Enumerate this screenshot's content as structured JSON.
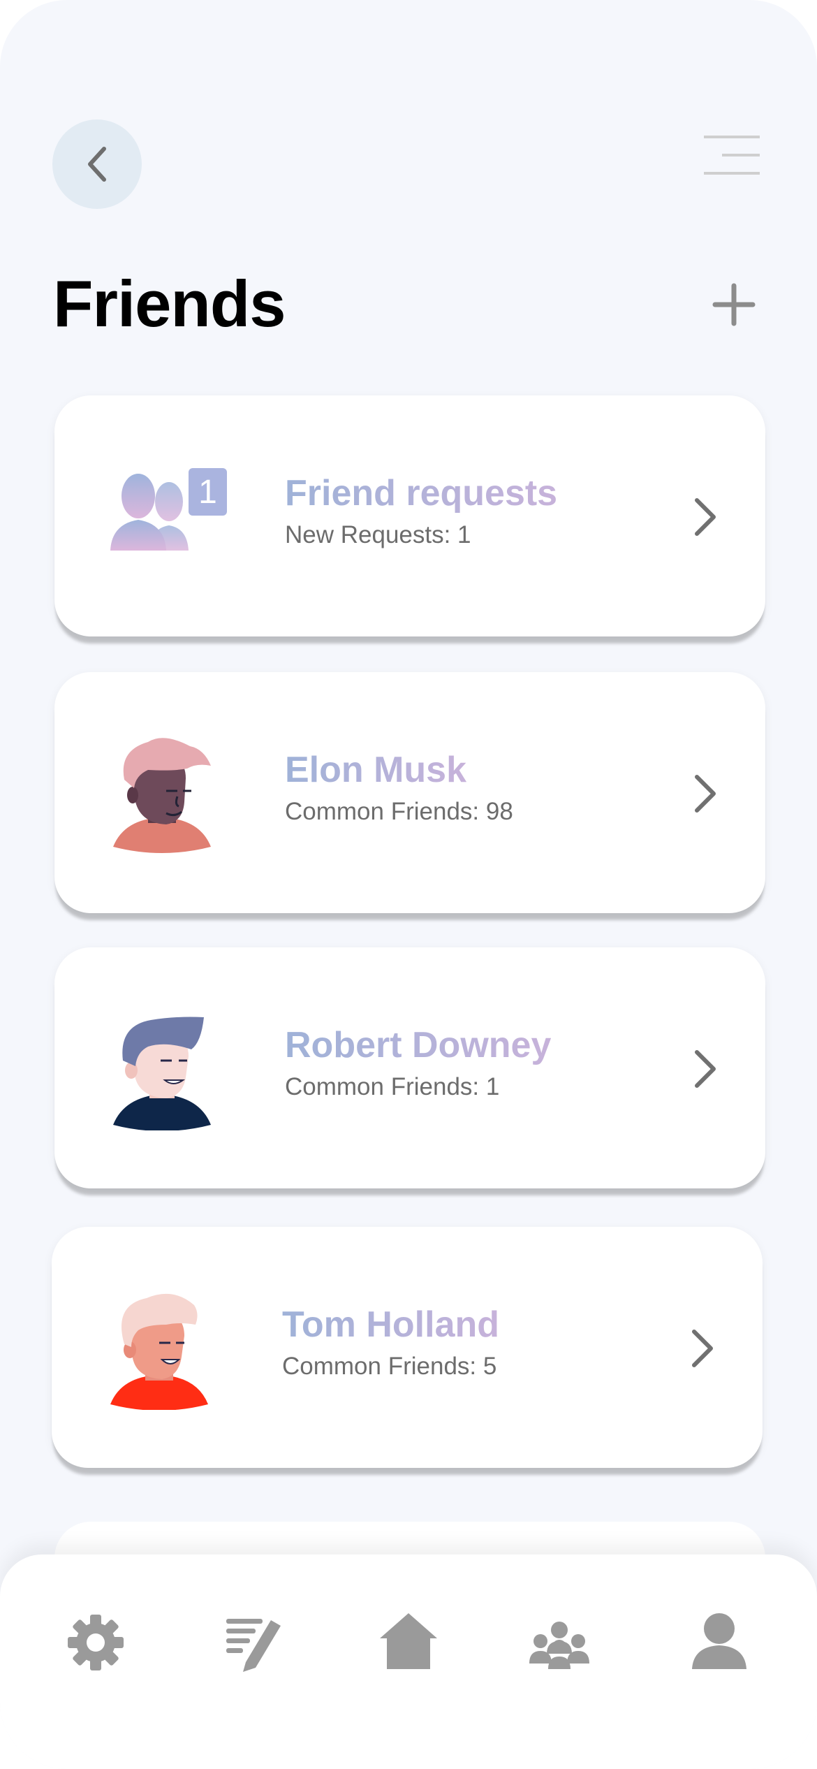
{
  "header": {
    "title": "Friends",
    "back_icon": "chevron-left-icon",
    "menu_icon": "menu-lines-icon",
    "add_icon": "plus-icon"
  },
  "friend_requests": {
    "title": "Friend requests",
    "subtitle": "New Requests: 1",
    "badge": "1",
    "icon": "users-icon"
  },
  "friends": [
    {
      "name": "Elon Musk",
      "subtitle": "Common Friends: 98"
    },
    {
      "name": "Robert Downey",
      "subtitle": "Common Friends: 1"
    },
    {
      "name": "Tom Holland",
      "subtitle": "Common Friends: 5"
    }
  ],
  "tab_bar": {
    "items": [
      "gear-icon",
      "edit-list-icon",
      "home-icon",
      "group-icon",
      "profile-icon"
    ]
  },
  "colors": {
    "background": "#f5f7fc",
    "name_gradient_start": "#9fb2d8",
    "name_gradient_end": "#c7b2da",
    "icon_gray": "#9a9a9a"
  }
}
